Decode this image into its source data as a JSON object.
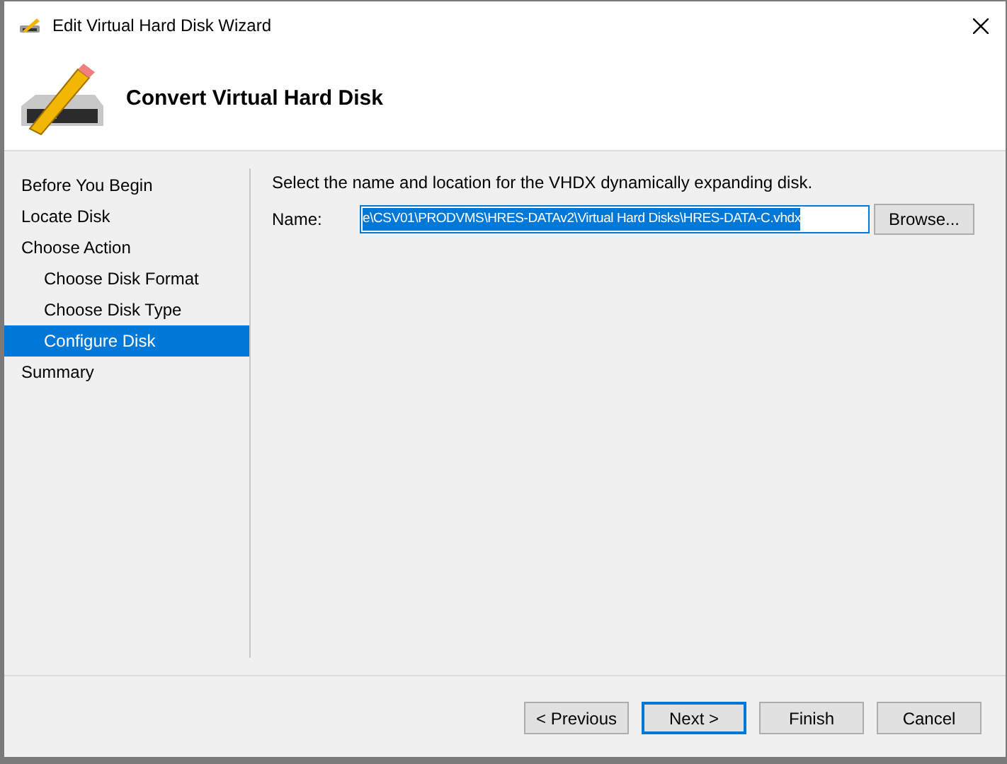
{
  "window": {
    "title": "Edit Virtual Hard Disk Wizard"
  },
  "header": {
    "title": "Convert Virtual Hard Disk"
  },
  "nav": [
    {
      "label": "Before You Begin",
      "selected": false
    },
    {
      "label": "Locate Disk",
      "selected": false
    },
    {
      "label": "Choose Action",
      "selected": false,
      "children": [
        {
          "label": "Choose Disk Format",
          "selected": false
        },
        {
          "label": "Choose Disk Type",
          "selected": false
        },
        {
          "label": "Configure Disk",
          "selected": true
        }
      ]
    },
    {
      "label": "Summary",
      "selected": false
    }
  ],
  "content": {
    "instruction": "Select the name and location for the VHDX dynamically expanding disk.",
    "name_label": "Name:",
    "name_value": "e\\CSV01\\PRODVMS\\HRES-DATAv2\\Virtual Hard Disks\\HRES-DATA-C.vhdx",
    "name_selected": true,
    "browse": "Browse..."
  },
  "buttons": [
    {
      "label": "< Previous",
      "default": false
    },
    {
      "label": "Next >",
      "default": true
    },
    {
      "label": "Finish",
      "default": false
    },
    {
      "label": "Cancel",
      "default": false
    }
  ]
}
